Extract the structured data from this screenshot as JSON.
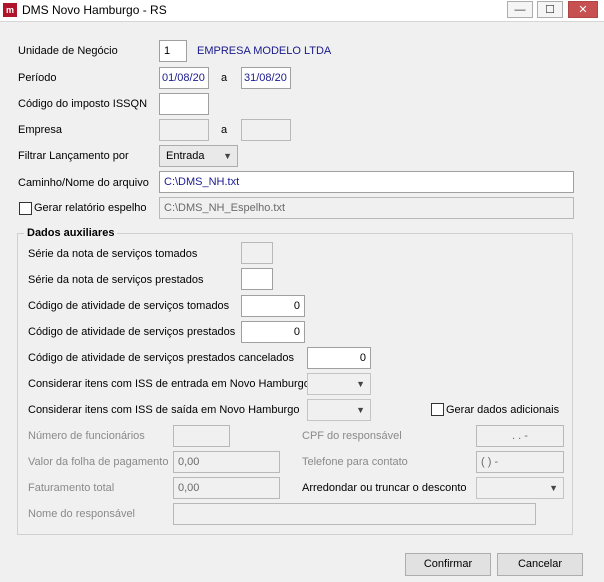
{
  "window": {
    "title": "DMS Novo Hamburgo - RS",
    "icon_text": "m",
    "minimize": "—",
    "maximize": "☐",
    "close": "✕"
  },
  "main": {
    "unidade_label": "Unidade de Negócio",
    "unidade_value": "1",
    "unidade_name": "EMPRESA MODELO LTDA",
    "periodo_label": "Período",
    "periodo_inicio": "01/08/20",
    "periodo_sep": "a",
    "periodo_fim": "31/08/20",
    "issqn_label": "Código do imposto ISSQN",
    "issqn_value": "",
    "empresa_label": "Empresa",
    "empresa_sep": "a",
    "filtrar_label": "Filtrar Lançamento por",
    "filtrar_value": "Entrada",
    "caminho_label": "Caminho/Nome do arquivo",
    "caminho_value": "C:\\DMS_NH.txt",
    "espelho_label": "Gerar relatório espelho",
    "espelho_value": "C:\\DMS_NH_Espelho.txt"
  },
  "aux": {
    "title": "Dados auxiliares",
    "serie_tomados_label": "Série da nota de serviços tomados",
    "serie_prestados_label": "Série da nota de serviços prestados",
    "ativ_tomados_label": "Código de atividade de serviços tomados",
    "ativ_tomados_value": "0",
    "ativ_prestados_label": "Código de atividade de serviços prestados",
    "ativ_prestados_value": "0",
    "ativ_cancel_label": "Código de atividade de serviços prestados cancelados",
    "ativ_cancel_value": "0",
    "iss_entrada_label": "Considerar itens com ISS de entrada em Novo Hamburgo",
    "iss_saida_label": "Considerar itens com ISS de saída em Novo Hamburgo",
    "gerar_adicionais_label": "Gerar dados adicionais",
    "num_func_label": "Número de funcionários",
    "cpf_label": "CPF do responsável",
    "cpf_mask": ". . -",
    "folha_label": "Valor da folha de pagamento",
    "folha_value": "0,00",
    "telefone_label": "Telefone para contato",
    "telefone_mask": "( )   -",
    "fat_label": "Faturamento total",
    "fat_value": "0,00",
    "arredondar_label": "Arredondar ou truncar o desconto",
    "nome_resp_label": "Nome do responsável"
  },
  "buttons": {
    "confirmar": "Confirmar",
    "cancelar": "Cancelar"
  },
  "icons": {
    "dropdown": "chevron-down-icon",
    "app": "app-logo-icon"
  },
  "colors": {
    "window_bg": "#f0f0f0",
    "close_button": "#c75050",
    "company_text": "#1a1a8a"
  }
}
